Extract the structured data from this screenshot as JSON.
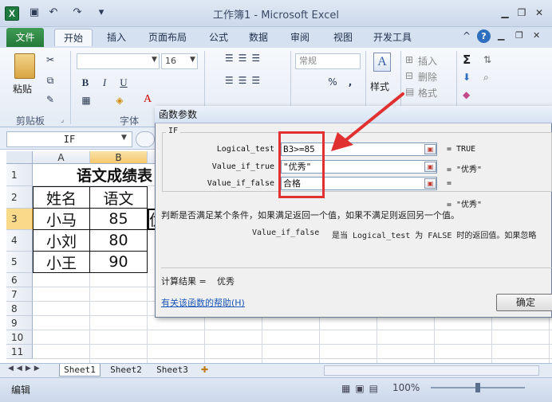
{
  "window": {
    "title": "工作簿1 - Microsoft Excel",
    "logo": "X",
    "qat_icons": [
      "save-icon",
      "undo-icon",
      "redo-icon",
      "customize-icon"
    ],
    "buttons": [
      "minimize-icon",
      "restore-icon",
      "close-icon"
    ]
  },
  "tabs": {
    "file": "文件",
    "items": [
      "开始",
      "插入",
      "页面布局",
      "公式",
      "数据",
      "审阅",
      "视图",
      "开发工具"
    ],
    "active": "开始"
  },
  "ribbon": {
    "paste": "粘贴",
    "clipboard_group": "剪贴板",
    "font_group": "字体",
    "font_size": "16",
    "bold": "B",
    "italic": "I",
    "underline": "U",
    "number_format": "常规",
    "percent": "%",
    "comma": ",",
    "styles": "样式",
    "insert": "插入",
    "delete": "删除",
    "format": "格式",
    "sum": "Σ"
  },
  "formula_bar": {
    "name_box": "IF"
  },
  "columns": [
    "A",
    "B"
  ],
  "rows": [
    "1",
    "2",
    "3",
    "4",
    "5",
    "6",
    "7",
    "8",
    "9",
    "10",
    "11"
  ],
  "sheet": {
    "title": "语文成绩表",
    "headers": [
      "姓名",
      "语文"
    ],
    "data": [
      [
        "小马",
        "85"
      ],
      [
        "小刘",
        "80"
      ],
      [
        "小王",
        "90"
      ]
    ],
    "c3_partial": "优"
  },
  "sheets": {
    "tabs": [
      "Sheet1",
      "Sheet2",
      "Sheet3"
    ],
    "active": "Sheet1"
  },
  "status": {
    "mode": "编辑",
    "zoom": "100%"
  },
  "dialog": {
    "title": "函数参数",
    "function": "IF",
    "args": [
      {
        "label": "Logical_test",
        "value": "B3>=85",
        "result": "= TRUE"
      },
      {
        "label": "Value_if_true",
        "value": "\"优秀\"",
        "result": "= \"优秀\""
      },
      {
        "label": "Value_if_false",
        "value": "合格",
        "result": "="
      }
    ],
    "overall_result": "= \"优秀\"",
    "description": "判断是否满足某个条件，如果满足返回一个值，如果不满足则返回另一个值。",
    "arg_help_label": "Value_if_false",
    "arg_help_text": "是当 Logical_test 为 FALSE 时的返回值。如果忽略",
    "calc_result_label": "计算结果 =",
    "calc_result_value": "优秀",
    "help_link": "有关该函数的帮助(H)",
    "ok": "确定"
  },
  "colors": {
    "accent_green": "#257a3a",
    "annotation_red": "#e03030",
    "selection_orange": "#f9d98a"
  }
}
